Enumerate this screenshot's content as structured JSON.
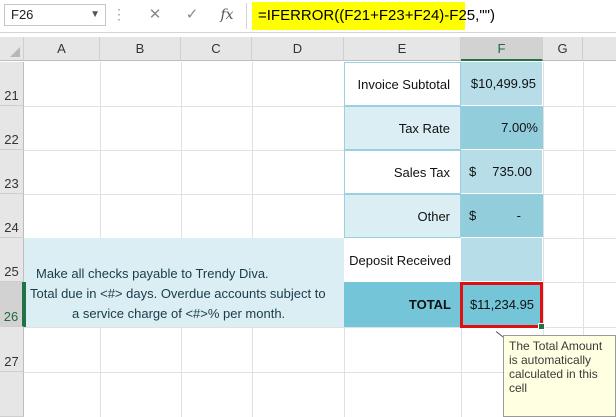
{
  "name_box": "F26",
  "formula": "=IFERROR((F21+F23+F24)-F25,\"\")",
  "formula_buttons": {
    "cancel": "✕",
    "enter": "✓",
    "fx": "fx"
  },
  "columns": [
    "A",
    "B",
    "C",
    "D",
    "E",
    "F",
    "G"
  ],
  "rows": [
    "21",
    "22",
    "23",
    "24",
    "25",
    "26",
    "27"
  ],
  "selected_cell": "F26",
  "invoice": {
    "subtotal_label": "Invoice Subtotal",
    "subtotal_value": "$10,499.95",
    "tax_rate_label": "Tax Rate",
    "tax_rate_value": "7.00%",
    "sales_tax_label": "Sales Tax",
    "sales_tax_currency": "$",
    "sales_tax_value": "735.00",
    "other_label": "Other",
    "other_currency": "$",
    "other_value": "-",
    "deposit_label": "Deposit Received",
    "deposit_value": "",
    "total_label": "TOTAL",
    "total_value": "$11,234.95"
  },
  "note": {
    "line1": "Make all checks payable to Trendy Diva.",
    "line2": "Total due in <#> days. Overdue accounts subject to",
    "line3": "a service charge of <#>% per month."
  },
  "tooltip": "The Total Amount\nis automatically\ncalculated in this\ncell",
  "colors": {
    "formula_highlight": "#ffff00",
    "selection": "#217346",
    "callout_border": "#e01010",
    "tooltip_bg": "#ffffe1"
  }
}
